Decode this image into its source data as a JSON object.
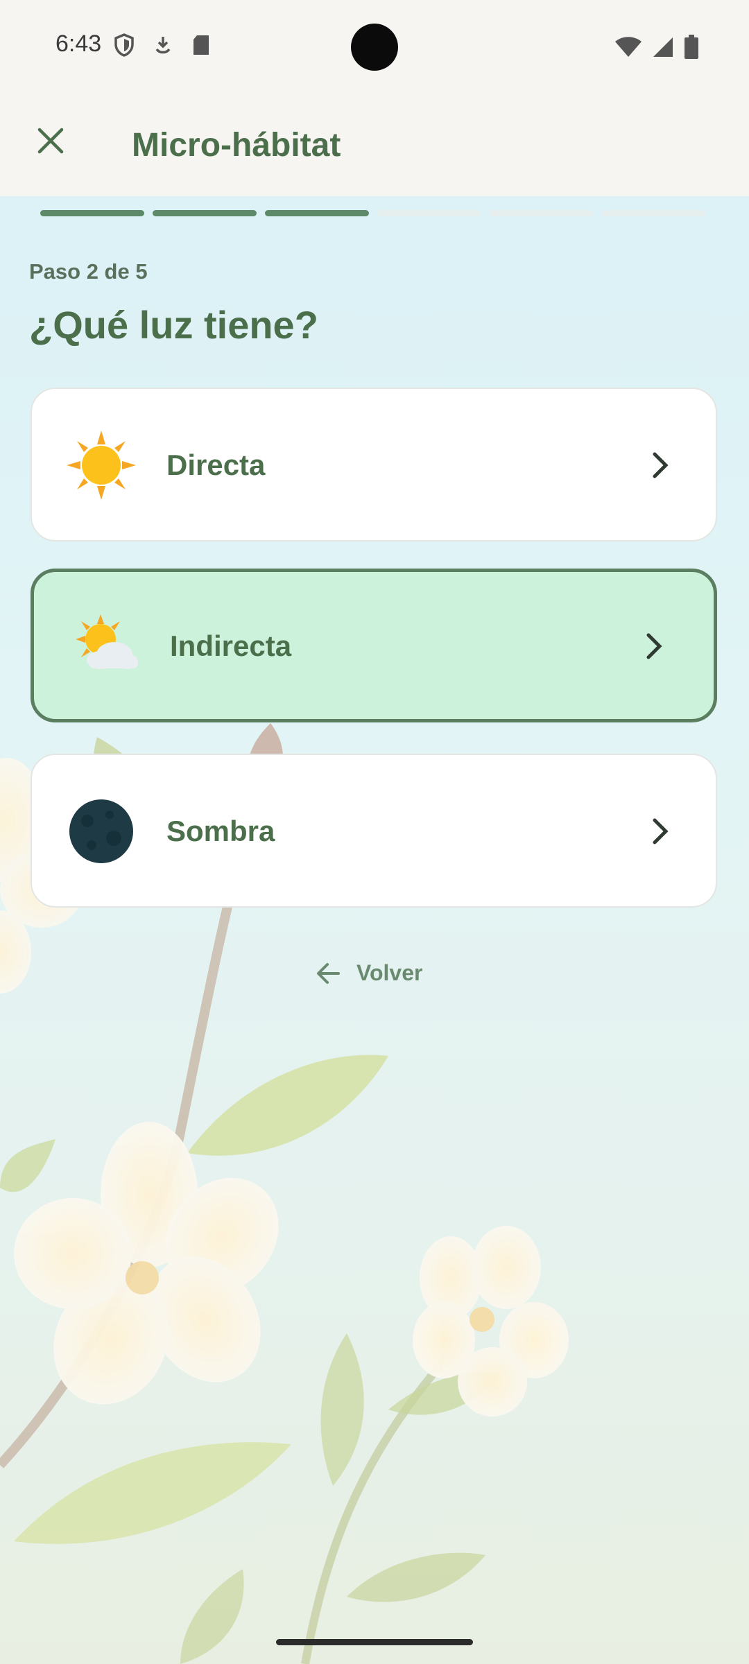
{
  "status_bar": {
    "time": "6:43",
    "left_icons": [
      "shield-icon",
      "download-icon",
      "sd-card-icon"
    ],
    "right_icons": [
      "wifi-icon",
      "signal-icon",
      "battery-icon"
    ]
  },
  "app_bar": {
    "close_icon": "close-icon",
    "title": "Micro-hábitat"
  },
  "progress": {
    "total_steps": 6,
    "completed_steps": 3
  },
  "step_label": "Paso 2 de 5",
  "question": "¿Qué luz tiene?",
  "options": [
    {
      "label": "Directa",
      "icon": "sun-icon",
      "selected": false
    },
    {
      "label": "Indirecta",
      "icon": "sun-behind-cloud-icon",
      "selected": true
    },
    {
      "label": "Sombra",
      "icon": "moon-icon",
      "selected": false
    }
  ],
  "back": {
    "label": "Volver",
    "icon": "arrow-left-icon"
  },
  "colors": {
    "primary": "#4b6e4b",
    "progress_done": "#5d8a68",
    "selected_bg": "#cdf2dc",
    "selected_border": "#5a7e5f"
  }
}
